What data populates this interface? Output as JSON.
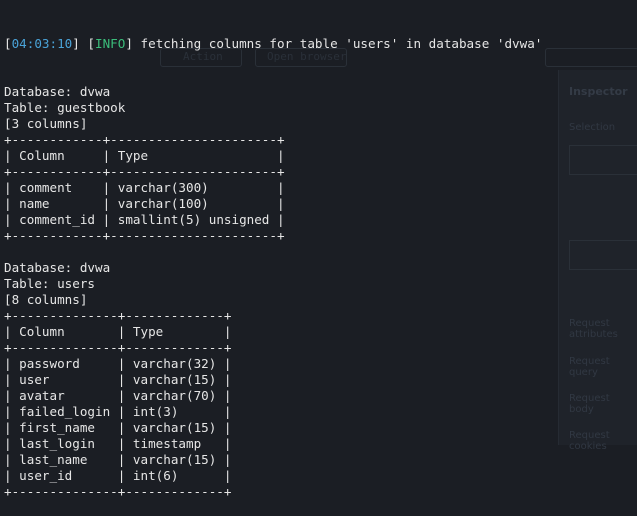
{
  "log": {
    "timestamp": "04:03:10",
    "level": "INFO",
    "message": "fetching columns for table 'users' in database 'dvwa'"
  },
  "tables": [
    {
      "database_line": "Database: dvwa",
      "table_line": "Table: guestbook",
      "count_line": "[3 columns]",
      "headers": [
        "Column",
        "Type"
      ],
      "rows": [
        [
          "comment",
          "varchar(300)"
        ],
        [
          "name",
          "varchar(100)"
        ],
        [
          "comment_id",
          "smallint(5) unsigned"
        ]
      ]
    },
    {
      "database_line": "Database: dvwa",
      "table_line": "Table: users",
      "count_line": "[8 columns]",
      "headers": [
        "Column",
        "Type"
      ],
      "rows": [
        [
          "password",
          "varchar(32)"
        ],
        [
          "user",
          "varchar(15)"
        ],
        [
          "avatar",
          "varchar(70)"
        ],
        [
          "failed_login",
          "int(3)"
        ],
        [
          "first_name",
          "varchar(15)"
        ],
        [
          "last_login",
          "timestamp"
        ],
        [
          "last_name",
          "varchar(15)"
        ],
        [
          "user_id",
          "int(6)"
        ]
      ]
    }
  ],
  "background_app": {
    "buttons": [
      "Action",
      "Open browser"
    ],
    "panel_title": "Inspector",
    "panel_labels": [
      "Selection",
      "Request attributes",
      "Request query",
      "Request body",
      "Request cookies"
    ]
  }
}
